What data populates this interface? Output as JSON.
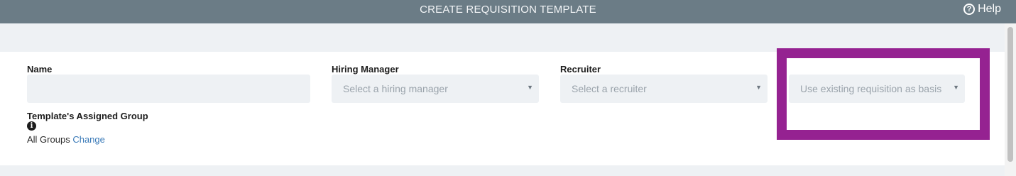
{
  "header": {
    "title": "CREATE REQUISITION TEMPLATE",
    "help_label": "Help",
    "help_icon": "question-circle-icon"
  },
  "form": {
    "name": {
      "label": "Name",
      "value": ""
    },
    "hiring_manager": {
      "label": "Hiring Manager",
      "placeholder": "Select a hiring manager"
    },
    "recruiter": {
      "label": "Recruiter",
      "placeholder": "Select a recruiter"
    },
    "basis": {
      "placeholder": "Use existing requisition as basis"
    },
    "assigned_group": {
      "label": "Template's Assigned Group",
      "value": "All Groups",
      "change_label": "Change",
      "info_icon": "info-circle-icon"
    }
  },
  "colors": {
    "header_bg": "#6b7c86",
    "highlight": "#952291",
    "link": "#3a7ab8"
  }
}
